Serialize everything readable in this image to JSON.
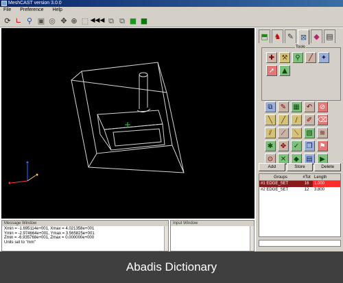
{
  "window": {
    "title": "MeshCAST version 3.0.0"
  },
  "menu": [
    "File",
    "Preference",
    "Help"
  ],
  "toolbar": {
    "icons": [
      "rotate-icon",
      "axes-icon",
      "zoom-icon",
      "zoom-window-icon",
      "fit-icon",
      "pan-icon",
      "translate-icon",
      "select-box-icon",
      "rewind-icon",
      "view-front-icon",
      "view-back-icon",
      "green-solid-icon",
      "green-cube-icon"
    ]
  },
  "tools_panel": {
    "label": "Tools",
    "tabs": [
      "geometry-tab-icon",
      "mesh-tab-icon",
      "edit-tab-icon",
      "chart-tab-icon",
      "shapes-tab-icon",
      "document-tab-icon"
    ]
  },
  "group_buttons": {
    "add": "Add",
    "store": "Store",
    "delete": "Delete"
  },
  "groups_table": {
    "headers": [
      "Groups",
      "#Tot",
      "Length"
    ],
    "rows": [
      {
        "group": "#1 EDGE_SET",
        "tot": "16",
        "length": "1.000"
      },
      {
        "group": "#2 EDGE_SET",
        "tot": "12",
        "length": "3.800"
      }
    ]
  },
  "message_window": {
    "title": "Message Window",
    "lines": [
      "Xmin = -1.695114e+001,  Xmax = 4.021358e+001",
      "Ymin = -2.974664e+001,  Ymax = 3.565825e+001",
      "Zmin = -6.935768e+001,  Zmax = 0.000000e+000",
      "Units set to \"mm\""
    ]
  },
  "input_window": {
    "title": "Input Window"
  },
  "footer": {
    "text": "Abadis Dictionary"
  },
  "colors": {
    "viewport_bg": "#000000",
    "selected_row": "#8a1a1a",
    "length_highlight": "#ff2a2a",
    "footer_bg": "#3f3f3f"
  }
}
